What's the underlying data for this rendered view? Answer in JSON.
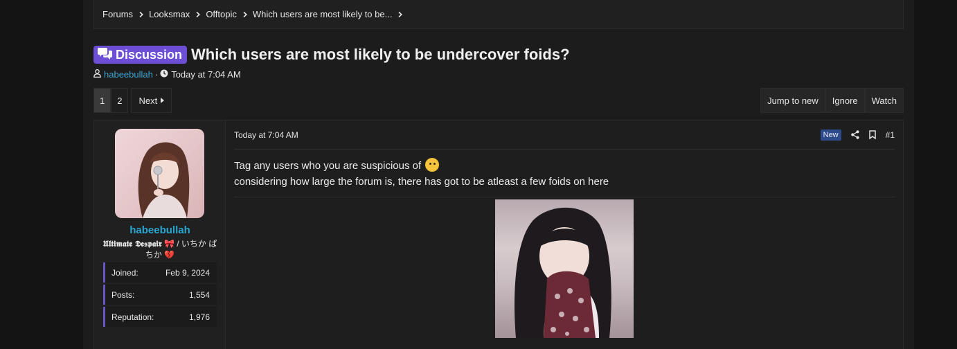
{
  "breadcrumb": [
    "Forums",
    "Looksmax",
    "Offtopic",
    "Which users are most likely to be..."
  ],
  "thread": {
    "label": "Discussion",
    "title": "Which users are most likely to be undercover foids?",
    "author": "habeebullah",
    "separator": "·",
    "date": "Today at 7:04 AM"
  },
  "pagination": {
    "pages": [
      "1",
      "2"
    ],
    "current": "1",
    "next_label": "Next"
  },
  "actions": {
    "jump_label": "Jump to new",
    "ignore_label": "Ignore",
    "watch_label": "Watch"
  },
  "post": {
    "username": "habeebullah",
    "user_title_gothic": "𝖀𝖑𝖙𝖎𝖒𝖆𝖙𝖊 𝕯𝖊𝖘𝖕𝖆𝖎𝖗",
    "user_title_emoji1": "🎀",
    "user_title_rest": " / いちか ぱちか ",
    "user_title_emoji2": "💔",
    "stats": [
      {
        "label": "Joined:",
        "value": "Feb 9, 2024"
      },
      {
        "label": "Posts:",
        "value": "1,554"
      },
      {
        "label": "Reputation:",
        "value": "1,976"
      }
    ],
    "date": "Today at 7:04 AM",
    "new_badge": "New",
    "number": "#1",
    "line1": "Tag any users who you are suspicious of",
    "line2": "considering how large the forum is, there has got to be atleast a few foids on here"
  },
  "colors": {
    "label_bg": "#6d4fd6",
    "link": "#3aa6d6",
    "username": "#28a6cf",
    "stat_accent": "#6757c4",
    "new_badge_bg": "#2d4a8a"
  },
  "icons": [
    "chevron-right-icon",
    "chat-bubbles-icon",
    "user-icon",
    "clock-icon",
    "caret-right-icon",
    "share-icon",
    "bookmark-icon",
    "thinking-emoji-icon"
  ]
}
